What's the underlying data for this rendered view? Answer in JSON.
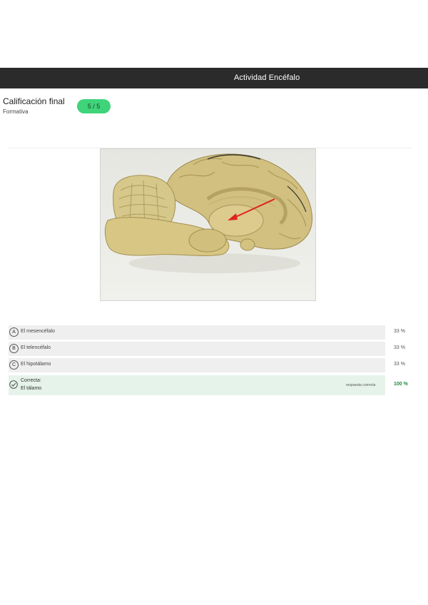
{
  "header": {
    "title": "Actividad Encéfalo"
  },
  "grade": {
    "title": "Calificación final",
    "subtitle": "Formativa",
    "score": "5 / 5"
  },
  "image": {
    "icon": "brain-sagittal-photo",
    "arrow_color": "#e0231d"
  },
  "options": [
    {
      "letter": "A",
      "text": "El mesencéfalo",
      "percent": "33 %"
    },
    {
      "letter": "B",
      "text": "El telencéfalo",
      "percent": "33 %"
    },
    {
      "letter": "C",
      "text": "El hipotálamo",
      "percent": "33 %"
    }
  ],
  "correct": {
    "label": "Correcta:",
    "text": "El tálamo",
    "note": "respuesta correcta",
    "percent": "100 %",
    "icon": "check-circle-icon"
  },
  "colors": {
    "topbar": "#2b2b2b",
    "badge": "#3fd47a",
    "correct_bg": "#e6f3ea",
    "correct_text": "#1f8a3e"
  }
}
